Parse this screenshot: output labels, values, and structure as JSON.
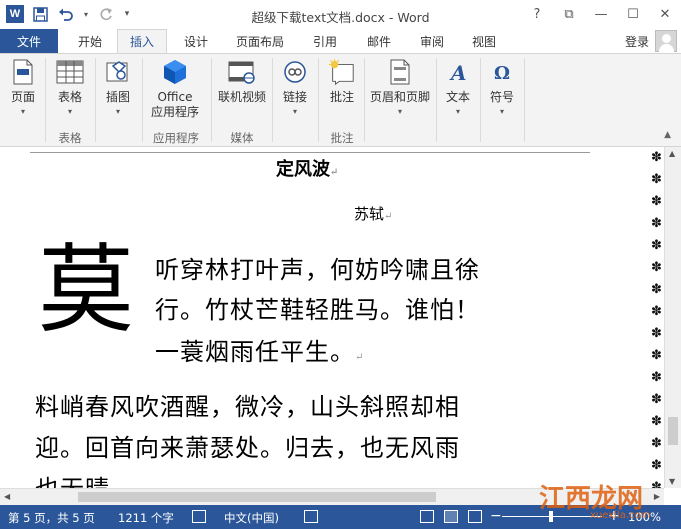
{
  "titlebar": {
    "app_icon": "W",
    "title": "超级下载text文档.docx - Word",
    "help": "?",
    "ribbon_display": "⧉",
    "minimize": "—",
    "maximize": "☐",
    "close": "✕"
  },
  "tabs": {
    "file": "文件",
    "items": [
      "开始",
      "插入",
      "设计",
      "页面布局",
      "引用",
      "邮件",
      "审阅",
      "视图"
    ],
    "active": "插入",
    "login": "登录"
  },
  "ribbon": {
    "buttons": [
      {
        "label": "页面",
        "icon": "page-icon"
      },
      {
        "label": "表格",
        "icon": "table-icon"
      },
      {
        "label": "插图",
        "icon": "illustrations-icon"
      },
      {
        "label_line1": "Office",
        "label_line2": "应用程序",
        "icon": "office-apps-icon"
      },
      {
        "label": "联机视频",
        "icon": "online-video-icon"
      },
      {
        "label": "链接",
        "icon": "link-icon"
      },
      {
        "label": "批注",
        "icon": "comment-icon"
      },
      {
        "label": "页眉和页脚",
        "icon": "header-footer-icon"
      },
      {
        "label": "文本",
        "icon": "text-icon"
      },
      {
        "label": "符号",
        "icon": "symbol-icon"
      }
    ],
    "groups": {
      "tables": "表格",
      "apps": "应用程序",
      "media": "媒体",
      "comments": "批注"
    }
  },
  "document": {
    "title": "定风波",
    "author": "苏轼",
    "dropcap": "莫",
    "lines": [
      "听穿林打叶声，何妨吟啸且徐",
      "行。竹杖芒鞋轻胜马。谁怕！",
      "一蓑烟雨任平生。",
      "料峭春风吹酒醒，微冷，山头斜照却相",
      "迎。回首向来萧瑟处。归去，也无风雨",
      "也无晴"
    ],
    "paragraph_mark": "↵"
  },
  "status": {
    "page": "第 5 页，共 5 页",
    "words": "1211 个字",
    "language": "中文(中国)",
    "zoom": "100%",
    "zoom_minus": "−",
    "zoom_plus": "+"
  },
  "watermark": {
    "text": "江西龙网",
    "sub": "xuexila.com"
  },
  "colors": {
    "accent": "#2b579a",
    "ribbon_bg": "#f3f3f3"
  }
}
